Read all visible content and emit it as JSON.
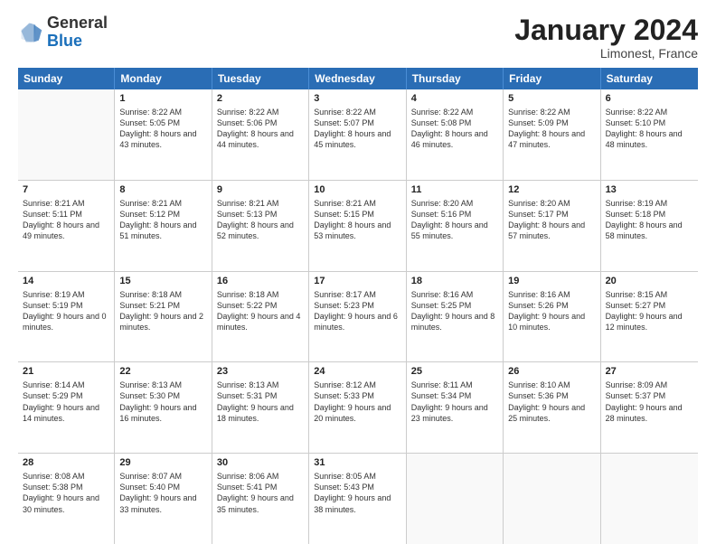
{
  "header": {
    "logo": {
      "general": "General",
      "blue": "Blue"
    },
    "title": "January 2024",
    "location": "Limonest, France"
  },
  "weekdays": [
    "Sunday",
    "Monday",
    "Tuesday",
    "Wednesday",
    "Thursday",
    "Friday",
    "Saturday"
  ],
  "weeks": [
    [
      {
        "day": "",
        "empty": true
      },
      {
        "day": "1",
        "sunrise": "Sunrise: 8:22 AM",
        "sunset": "Sunset: 5:05 PM",
        "daylight": "Daylight: 8 hours and 43 minutes."
      },
      {
        "day": "2",
        "sunrise": "Sunrise: 8:22 AM",
        "sunset": "Sunset: 5:06 PM",
        "daylight": "Daylight: 8 hours and 44 minutes."
      },
      {
        "day": "3",
        "sunrise": "Sunrise: 8:22 AM",
        "sunset": "Sunset: 5:07 PM",
        "daylight": "Daylight: 8 hours and 45 minutes."
      },
      {
        "day": "4",
        "sunrise": "Sunrise: 8:22 AM",
        "sunset": "Sunset: 5:08 PM",
        "daylight": "Daylight: 8 hours and 46 minutes."
      },
      {
        "day": "5",
        "sunrise": "Sunrise: 8:22 AM",
        "sunset": "Sunset: 5:09 PM",
        "daylight": "Daylight: 8 hours and 47 minutes."
      },
      {
        "day": "6",
        "sunrise": "Sunrise: 8:22 AM",
        "sunset": "Sunset: 5:10 PM",
        "daylight": "Daylight: 8 hours and 48 minutes."
      }
    ],
    [
      {
        "day": "7",
        "sunrise": "Sunrise: 8:21 AM",
        "sunset": "Sunset: 5:11 PM",
        "daylight": "Daylight: 8 hours and 49 minutes."
      },
      {
        "day": "8",
        "sunrise": "Sunrise: 8:21 AM",
        "sunset": "Sunset: 5:12 PM",
        "daylight": "Daylight: 8 hours and 51 minutes."
      },
      {
        "day": "9",
        "sunrise": "Sunrise: 8:21 AM",
        "sunset": "Sunset: 5:13 PM",
        "daylight": "Daylight: 8 hours and 52 minutes."
      },
      {
        "day": "10",
        "sunrise": "Sunrise: 8:21 AM",
        "sunset": "Sunset: 5:15 PM",
        "daylight": "Daylight: 8 hours and 53 minutes."
      },
      {
        "day": "11",
        "sunrise": "Sunrise: 8:20 AM",
        "sunset": "Sunset: 5:16 PM",
        "daylight": "Daylight: 8 hours and 55 minutes."
      },
      {
        "day": "12",
        "sunrise": "Sunrise: 8:20 AM",
        "sunset": "Sunset: 5:17 PM",
        "daylight": "Daylight: 8 hours and 57 minutes."
      },
      {
        "day": "13",
        "sunrise": "Sunrise: 8:19 AM",
        "sunset": "Sunset: 5:18 PM",
        "daylight": "Daylight: 8 hours and 58 minutes."
      }
    ],
    [
      {
        "day": "14",
        "sunrise": "Sunrise: 8:19 AM",
        "sunset": "Sunset: 5:19 PM",
        "daylight": "Daylight: 9 hours and 0 minutes."
      },
      {
        "day": "15",
        "sunrise": "Sunrise: 8:18 AM",
        "sunset": "Sunset: 5:21 PM",
        "daylight": "Daylight: 9 hours and 2 minutes."
      },
      {
        "day": "16",
        "sunrise": "Sunrise: 8:18 AM",
        "sunset": "Sunset: 5:22 PM",
        "daylight": "Daylight: 9 hours and 4 minutes."
      },
      {
        "day": "17",
        "sunrise": "Sunrise: 8:17 AM",
        "sunset": "Sunset: 5:23 PM",
        "daylight": "Daylight: 9 hours and 6 minutes."
      },
      {
        "day": "18",
        "sunrise": "Sunrise: 8:16 AM",
        "sunset": "Sunset: 5:25 PM",
        "daylight": "Daylight: 9 hours and 8 minutes."
      },
      {
        "day": "19",
        "sunrise": "Sunrise: 8:16 AM",
        "sunset": "Sunset: 5:26 PM",
        "daylight": "Daylight: 9 hours and 10 minutes."
      },
      {
        "day": "20",
        "sunrise": "Sunrise: 8:15 AM",
        "sunset": "Sunset: 5:27 PM",
        "daylight": "Daylight: 9 hours and 12 minutes."
      }
    ],
    [
      {
        "day": "21",
        "sunrise": "Sunrise: 8:14 AM",
        "sunset": "Sunset: 5:29 PM",
        "daylight": "Daylight: 9 hours and 14 minutes."
      },
      {
        "day": "22",
        "sunrise": "Sunrise: 8:13 AM",
        "sunset": "Sunset: 5:30 PM",
        "daylight": "Daylight: 9 hours and 16 minutes."
      },
      {
        "day": "23",
        "sunrise": "Sunrise: 8:13 AM",
        "sunset": "Sunset: 5:31 PM",
        "daylight": "Daylight: 9 hours and 18 minutes."
      },
      {
        "day": "24",
        "sunrise": "Sunrise: 8:12 AM",
        "sunset": "Sunset: 5:33 PM",
        "daylight": "Daylight: 9 hours and 20 minutes."
      },
      {
        "day": "25",
        "sunrise": "Sunrise: 8:11 AM",
        "sunset": "Sunset: 5:34 PM",
        "daylight": "Daylight: 9 hours and 23 minutes."
      },
      {
        "day": "26",
        "sunrise": "Sunrise: 8:10 AM",
        "sunset": "Sunset: 5:36 PM",
        "daylight": "Daylight: 9 hours and 25 minutes."
      },
      {
        "day": "27",
        "sunrise": "Sunrise: 8:09 AM",
        "sunset": "Sunset: 5:37 PM",
        "daylight": "Daylight: 9 hours and 28 minutes."
      }
    ],
    [
      {
        "day": "28",
        "sunrise": "Sunrise: 8:08 AM",
        "sunset": "Sunset: 5:38 PM",
        "daylight": "Daylight: 9 hours and 30 minutes."
      },
      {
        "day": "29",
        "sunrise": "Sunrise: 8:07 AM",
        "sunset": "Sunset: 5:40 PM",
        "daylight": "Daylight: 9 hours and 33 minutes."
      },
      {
        "day": "30",
        "sunrise": "Sunrise: 8:06 AM",
        "sunset": "Sunset: 5:41 PM",
        "daylight": "Daylight: 9 hours and 35 minutes."
      },
      {
        "day": "31",
        "sunrise": "Sunrise: 8:05 AM",
        "sunset": "Sunset: 5:43 PM",
        "daylight": "Daylight: 9 hours and 38 minutes."
      },
      {
        "day": "",
        "empty": true
      },
      {
        "day": "",
        "empty": true
      },
      {
        "day": "",
        "empty": true
      }
    ]
  ]
}
